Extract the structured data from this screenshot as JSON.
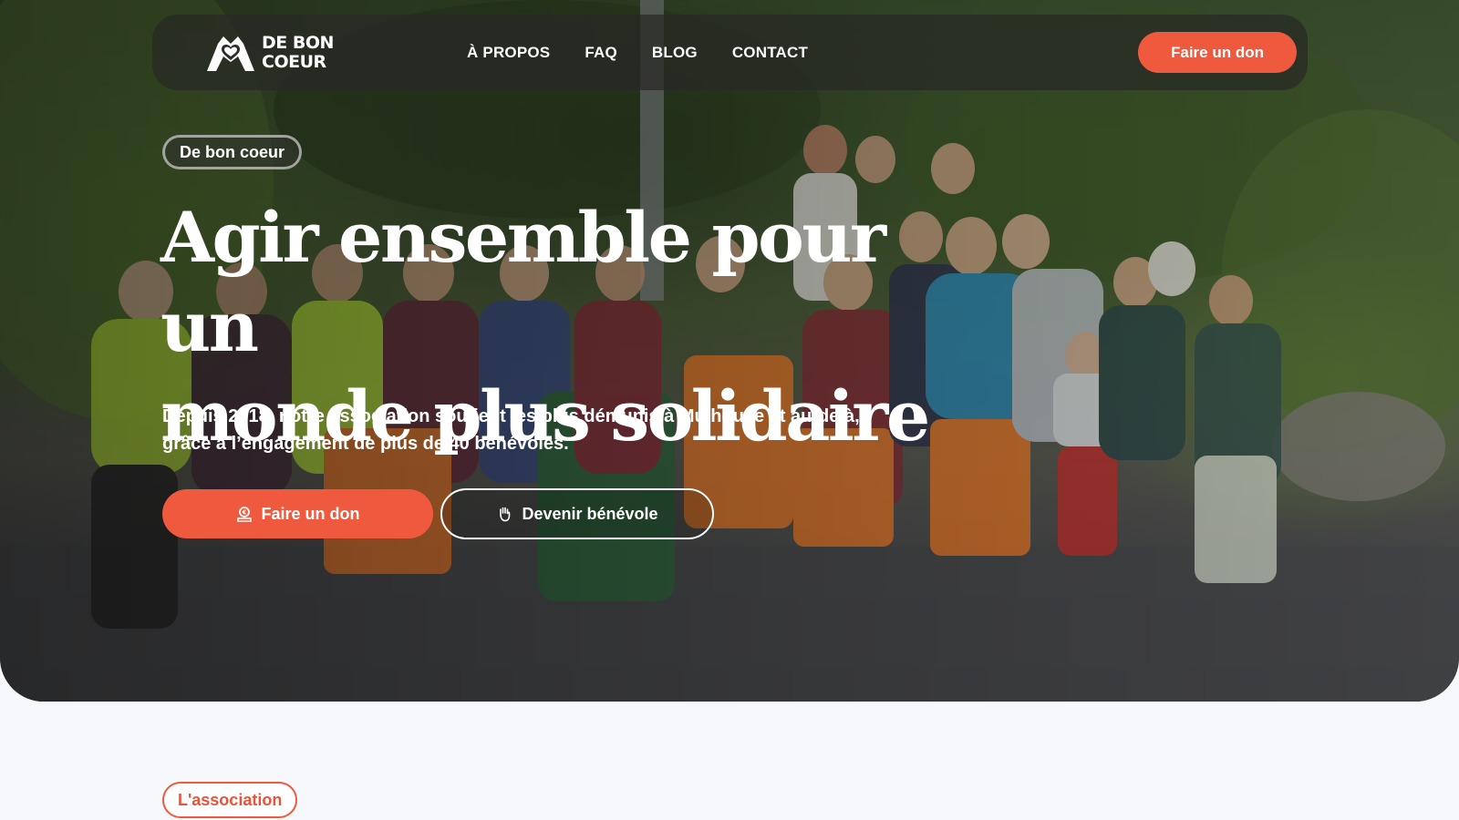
{
  "brand": {
    "name_line1": "DE BON",
    "name_line2": "COEUR",
    "logo_icon": "heart-hands-icon"
  },
  "nav": {
    "links": [
      "À PROPOS",
      "FAQ",
      "BLOG",
      "CONTACT"
    ],
    "cta_label": "Faire un don"
  },
  "hero": {
    "tag": "De bon coeur",
    "title_line1": "Agir ensemble pour un",
    "title_line2": "monde plus solidaire",
    "subtitle_line1": "Depuis 2018, notre association soutient les plus démunis à Mulhouse et au-delà,",
    "subtitle_line2": "grâce à l’engagement de plus de 40 bénévoles.",
    "primary_button": {
      "label": "Faire un don",
      "icon": "donation-icon"
    },
    "secondary_button": {
      "label": "Devenir bénévole",
      "icon": "raised-hand-icon"
    }
  },
  "section": {
    "tag": "L'association"
  },
  "colors": {
    "accent": "#ef5a3f",
    "page_bg": "#f6f8fb",
    "navbar_bg": "rgba(40,40,38,0.72)"
  }
}
